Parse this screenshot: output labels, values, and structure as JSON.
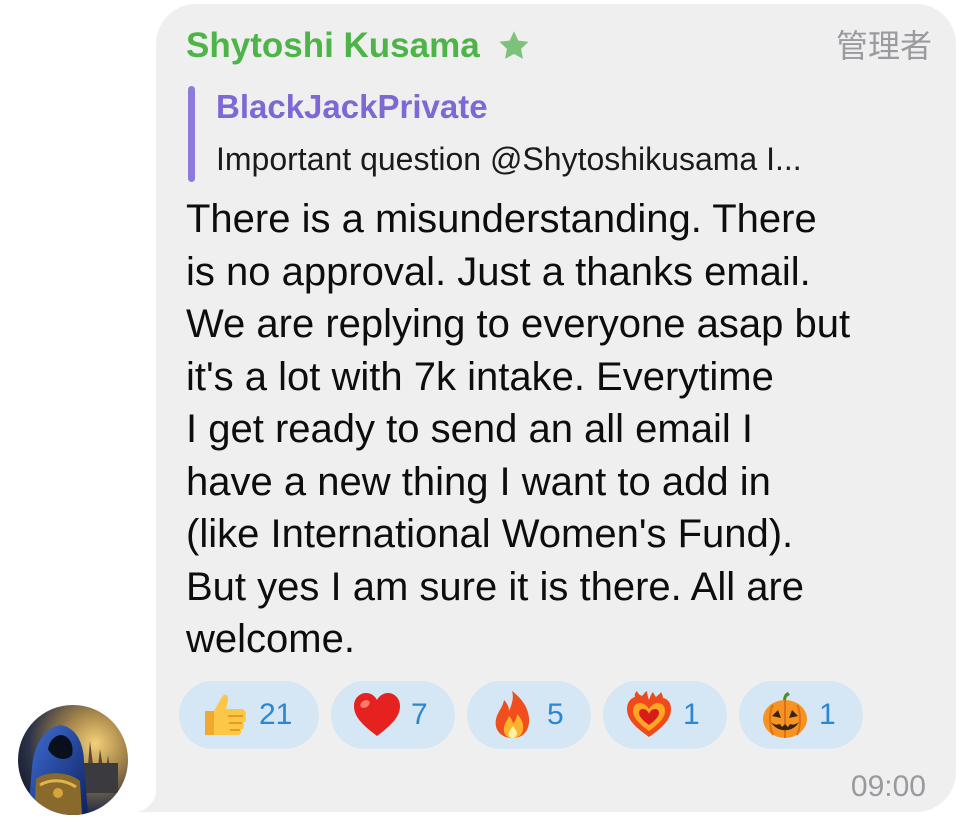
{
  "message": {
    "sender": "Shytoshi Kusama",
    "sender_icon": "star-icon",
    "admin_label": "管理者",
    "reply": {
      "author": "BlackJackPrivate",
      "snippet": "Important question @Shytoshikusama I..."
    },
    "body": "There is a misunderstanding.  There\nis no approval.  Just a thanks email.\nWe are replying to everyone asap but\nit's a lot with 7k intake. Everytime\nI get ready to send an all email I\nhave a new thing I want to add in\n(like International Women's Fund).\nBut yes I am sure it is there. All are\nwelcome.",
    "reactions": [
      {
        "icon": "thumbs-up-icon",
        "count": "21"
      },
      {
        "icon": "red-heart-icon",
        "count": "7"
      },
      {
        "icon": "fire-icon",
        "count": "5"
      },
      {
        "icon": "heart-on-fire-icon",
        "count": "1"
      },
      {
        "icon": "jack-o-lantern-icon",
        "count": "1"
      }
    ],
    "time": "09:00"
  },
  "colors": {
    "bubble": "#efeff0",
    "sender_name": "#4db447",
    "reply_accent": "#7d68d4",
    "reaction_bg": "#d5e6f4",
    "reaction_count": "#2b86d4",
    "muted_text": "#999a9e"
  }
}
